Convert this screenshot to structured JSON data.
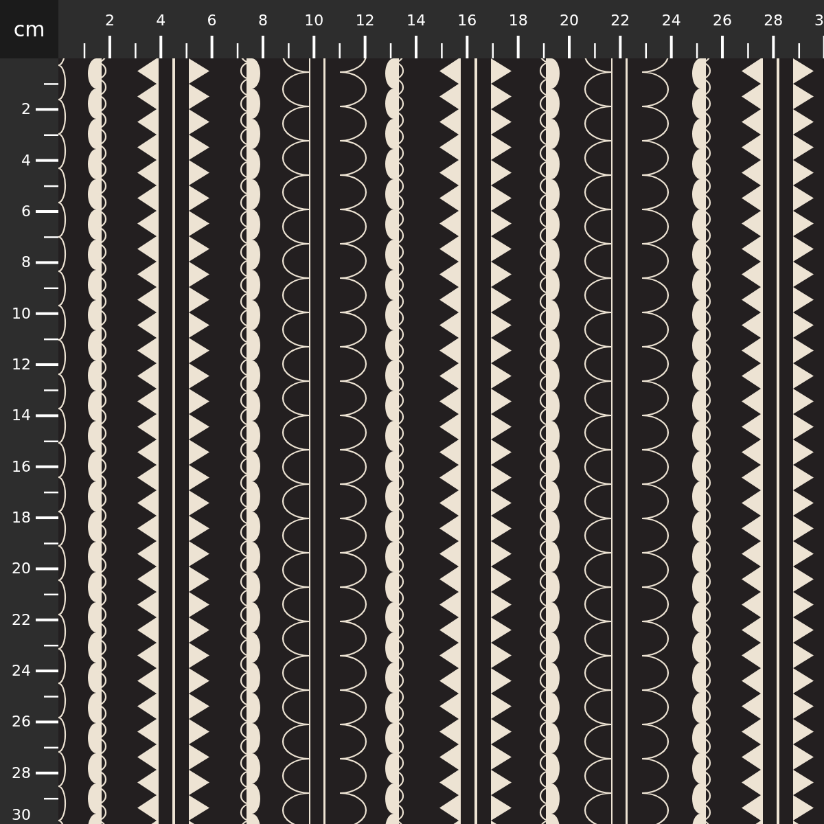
{
  "unit_label": "cm",
  "top_ruler": {
    "labels": [
      "2",
      "4",
      "6",
      "8",
      "10",
      "12",
      "14",
      "16",
      "18",
      "20",
      "22",
      "24",
      "26",
      "28",
      "3"
    ]
  },
  "left_ruler": {
    "labels": [
      "2",
      "4",
      "6",
      "8",
      "10",
      "12",
      "14",
      "16",
      "18",
      "20",
      "22",
      "24",
      "26",
      "28",
      "30"
    ]
  }
}
